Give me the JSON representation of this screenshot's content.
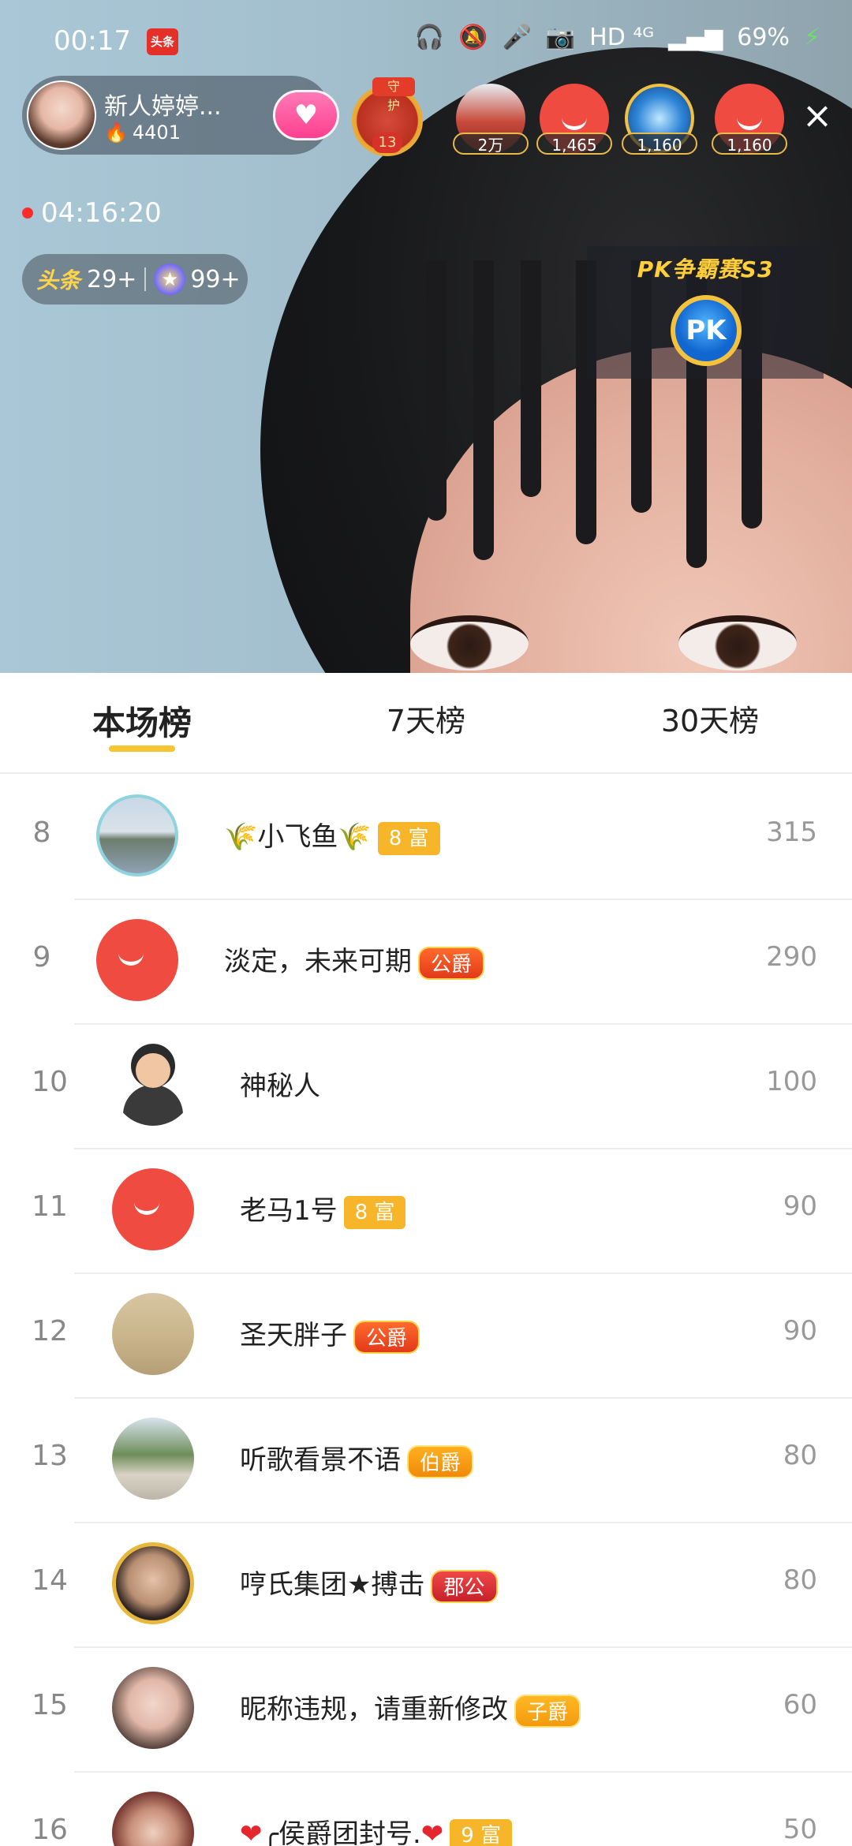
{
  "status_bar": {
    "time": "00:17",
    "app_badge": "头条",
    "indicators": "HD ⁴ᴳ",
    "battery": "69%"
  },
  "host": {
    "name": "新人婷婷...",
    "heat": "4401"
  },
  "guard": {
    "tag": "守护",
    "count": "13"
  },
  "viewers": [
    {
      "count": "2万"
    },
    {
      "count": "1,465"
    },
    {
      "count": "1,160"
    },
    {
      "count": "1,160"
    }
  ],
  "live_timer": "04:16:20",
  "badges": {
    "toutiao_label": "头条",
    "toutiao_count": "29+",
    "star_count": "99+"
  },
  "pk": {
    "title": "PK争霸赛S3",
    "button": "PK"
  },
  "tabs": [
    {
      "label": "本场榜",
      "active": true
    },
    {
      "label": "7天榜",
      "active": false
    },
    {
      "label": "30天榜",
      "active": false
    }
  ],
  "ranking": [
    {
      "rank": "8",
      "name": "小飞鱼",
      "tag": "8 富",
      "tag_type": "rich",
      "score": "315",
      "decor": "wheat",
      "avatar": "lake"
    },
    {
      "rank": "9",
      "name": "淡定，未来可期",
      "tag": "公爵",
      "tag_type": "duke",
      "score": "290",
      "avatar": "red-smile"
    },
    {
      "rank": "10",
      "name": "神秘人",
      "tag": "",
      "tag_type": "",
      "score": "100",
      "avatar": "spy"
    },
    {
      "rank": "11",
      "name": "老马1号",
      "tag": "8 富",
      "tag_type": "rich",
      "score": "90",
      "avatar": "red-smile"
    },
    {
      "rank": "12",
      "name": "圣天胖子",
      "tag": "公爵",
      "tag_type": "duke",
      "score": "90",
      "avatar": "sand"
    },
    {
      "rank": "13",
      "name": "听歌看景不语",
      "tag": "伯爵",
      "tag_type": "earl",
      "score": "80",
      "avatar": "hill"
    },
    {
      "rank": "14",
      "name": "哼氏集团★搏击",
      "tag": "郡公",
      "tag_type": "jun",
      "score": "80",
      "avatar": "boy"
    },
    {
      "rank": "15",
      "name": "昵称违规，请重新修改",
      "tag": "子爵",
      "tag_type": "zi",
      "score": "60",
      "avatar": "girl"
    },
    {
      "rank": "16",
      "name": "╭侯爵团封号.",
      "tag": "9 富",
      "tag_type": "rich",
      "score": "50",
      "decor": "heart",
      "avatar": "girl2"
    }
  ]
}
